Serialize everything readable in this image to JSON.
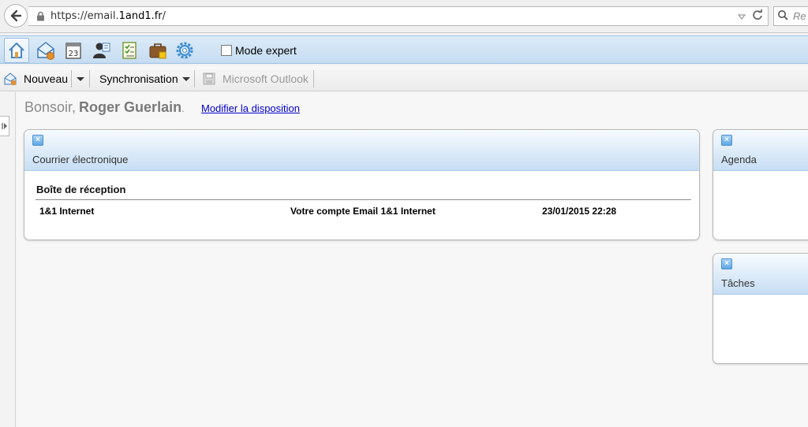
{
  "browser": {
    "url_prefix": "https://email.",
    "url_host": "1and1.fr",
    "url_suffix": "/",
    "search_placeholder": "Re"
  },
  "toolbar": {
    "icons": [
      "home-icon",
      "mail-icon",
      "calendar-icon",
      "contacts-icon",
      "tasks-icon",
      "briefcase-icon",
      "settings-icon"
    ],
    "calendar_day": "23",
    "mode_expert_label": "Mode expert",
    "mode_expert_checked": false
  },
  "secondary_toolbar": {
    "new_label": "Nouveau",
    "sync_label": "Synchronisation",
    "outlook_label": "Microsoft Outlook"
  },
  "greeting": {
    "hello": "Bonsoir,",
    "name": "Roger Guerlain",
    "dot": ".",
    "modify_link": "Modifier la disposition"
  },
  "widgets": {
    "mail": {
      "title": "Courrier électronique",
      "inbox_title": "Boîte de réception",
      "rows": [
        {
          "from": "1&1 Internet",
          "subject": "Votre compte Email 1&1 Internet",
          "date": "23/01/2015 22:28"
        }
      ]
    },
    "agenda": {
      "title": "Agenda"
    },
    "tasks": {
      "title": "Tâches"
    }
  },
  "colors": {
    "accent_blue": "#c7def4",
    "link": "#0000cc"
  }
}
